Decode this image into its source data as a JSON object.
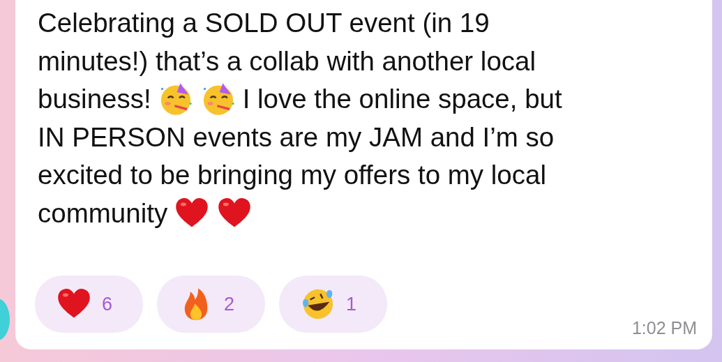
{
  "message": {
    "lines": [
      [
        {
          "kind": "text",
          "text": "Celebrating a SOLD OUT event (in 19"
        }
      ],
      [
        {
          "kind": "text",
          "text": "minutes!) that’s a collab with another local"
        }
      ],
      [
        {
          "kind": "text",
          "text": "business!"
        },
        {
          "kind": "party"
        },
        {
          "kind": "party"
        },
        {
          "kind": "text",
          "text": "I love the online space, but"
        }
      ],
      [
        {
          "kind": "text",
          "text": "IN PERSON events are my JAM and I’m so"
        }
      ],
      [
        {
          "kind": "text",
          "text": "excited to be bringing my offers to my local"
        }
      ],
      [
        {
          "kind": "text",
          "text": "community"
        },
        {
          "kind": "heart"
        },
        {
          "kind": "heart"
        }
      ]
    ],
    "reactions": [
      {
        "kind": "heart",
        "count": "6"
      },
      {
        "kind": "fire",
        "count": "2"
      },
      {
        "kind": "laugh",
        "count": "1"
      }
    ],
    "time": "1:02 PM"
  }
}
